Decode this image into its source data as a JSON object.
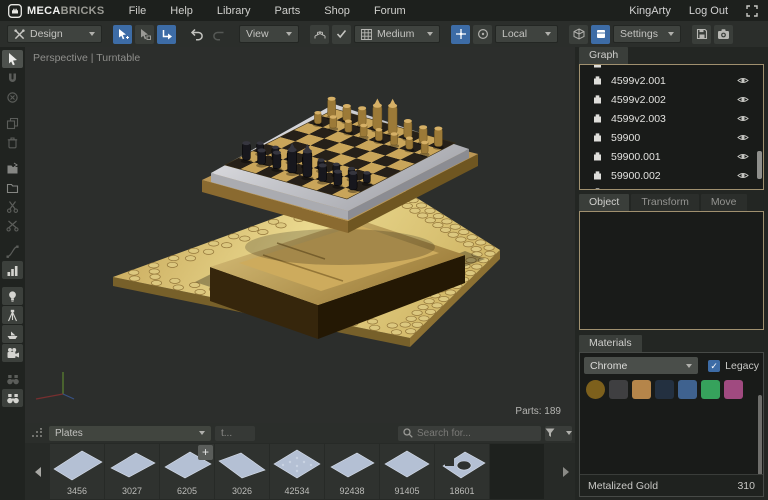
{
  "menubar": {
    "logo_strong": "MECA",
    "logo_light": "BRICKS",
    "items": [
      "File",
      "Help",
      "Library",
      "Parts",
      "Shop",
      "Forum"
    ],
    "username": "KingArty",
    "logout_label": "Log Out"
  },
  "toolbar": {
    "design_label": "Design",
    "view_label": "View",
    "grid_label": "Medium",
    "space_label": "Local",
    "settings_label": "Settings",
    "icons": [
      "design-tools-icon",
      "select-add-icon",
      "select-box-icon",
      "select-corner-icon",
      "undo-icon",
      "redo-icon",
      "build-grid-icon",
      "check-icon",
      "grid-icon",
      "move-crosshair-icon",
      "pivot-circle-icon",
      "cube-icon",
      "box-icon",
      "save-icon",
      "screenshot-camera-icon"
    ]
  },
  "left_toolbar": {
    "icons": [
      "select-pointer-icon",
      "magnet-icon",
      "rotate-circle-icon",
      "duplicate-icon",
      "trash-icon",
      "group-icon",
      "folder-icon",
      "scissors-icon",
      "split-icon",
      "curve-icon",
      "statistics-icon",
      "lightbulb-icon",
      "tripod-icon",
      "boat-icon",
      "movie-camera-icon",
      "binoculars-off-icon",
      "binoculars-icon"
    ]
  },
  "viewport": {
    "mode_label": "Perspective | Turntable",
    "parts_count_label": "Parts: 189"
  },
  "graph_panel": {
    "tab_label": "Graph",
    "items": [
      {
        "label": "4599v2.001"
      },
      {
        "label": "4599v2.002"
      },
      {
        "label": "4599v2.003"
      },
      {
        "label": "59900"
      },
      {
        "label": "59900.001"
      },
      {
        "label": "59900.002"
      }
    ]
  },
  "object_panel": {
    "tabs": [
      "Object",
      "Transform",
      "Move"
    ],
    "active_tab": "Object"
  },
  "materials_panel": {
    "tab_label": "Materials",
    "category_label": "Chrome",
    "legacy_label": "Legacy",
    "swatches": [
      {
        "name": "metalized-gold",
        "color": "#7d601c"
      },
      {
        "name": "dark-gray",
        "color": "#3f3f41"
      },
      {
        "name": "gold",
        "color": "#b5854a"
      },
      {
        "name": "dark-navy",
        "color": "#233040"
      },
      {
        "name": "blue",
        "color": "#3f628f"
      },
      {
        "name": "green",
        "color": "#36a25c"
      },
      {
        "name": "magenta",
        "color": "#a04a80"
      }
    ],
    "status_name": "Metalized Gold",
    "status_value": "310"
  },
  "parts_bar": {
    "category_label": "Plates",
    "breadcrumb_label": "t...",
    "search_placeholder": "Search for...",
    "add_label": "+",
    "parts": [
      {
        "id": "3456"
      },
      {
        "id": "3027"
      },
      {
        "id": "6205"
      },
      {
        "id": "3026"
      },
      {
        "id": "42534"
      },
      {
        "id": "92438"
      },
      {
        "id": "91405"
      },
      {
        "id": "18601"
      }
    ]
  },
  "colors": {
    "accent_blue": "#3d6ca6",
    "panel_border": "#a0906f",
    "gold": "#c9a85c"
  }
}
